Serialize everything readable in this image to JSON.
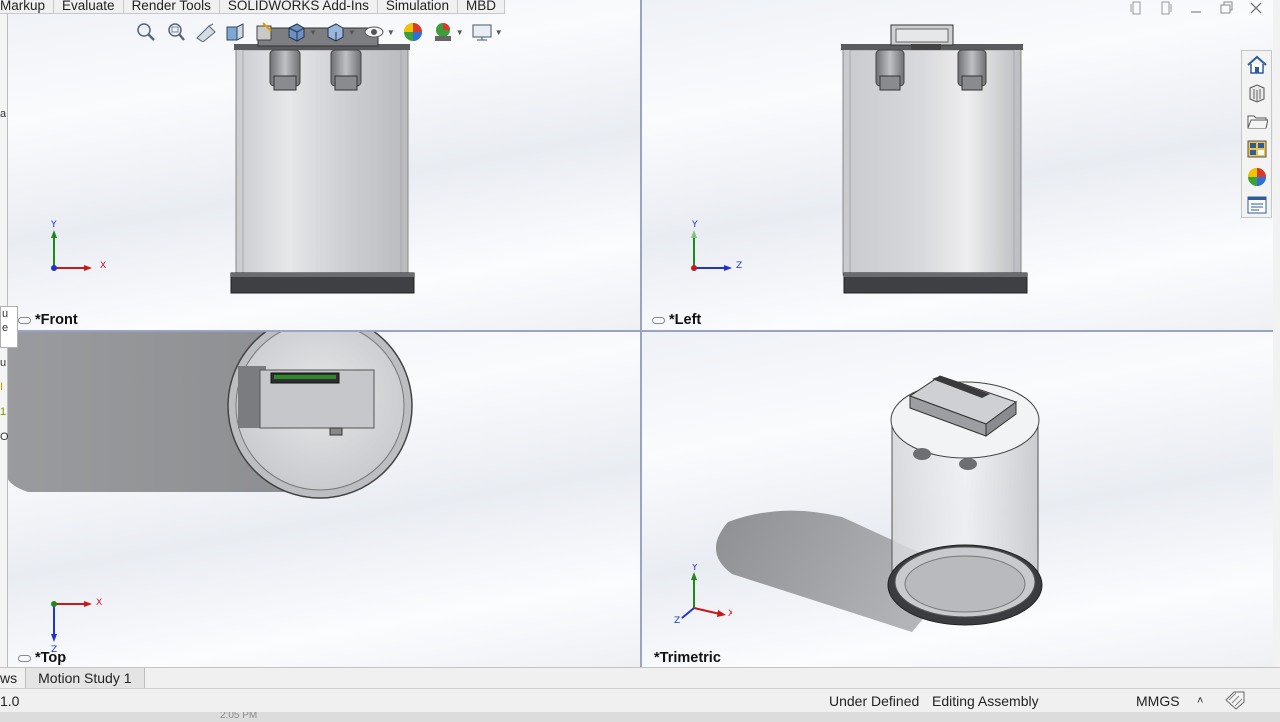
{
  "ribbon": {
    "tabs": [
      "Markup",
      "Evaluate",
      "Render Tools",
      "SOLIDWORKS Add-Ins",
      "Simulation",
      "MBD"
    ]
  },
  "window_controls": {
    "icons": [
      "restore-left-icon",
      "restore-right-icon",
      "minimize-icon",
      "maximize-icon",
      "close-icon"
    ]
  },
  "heads_up_toolbar": {
    "icons": [
      "zoom-to-fit-icon",
      "zoom-to-area-icon",
      "previous-view-icon",
      "section-view-icon",
      "dynamic-annotation-icon",
      "view-orientation-icon",
      "display-style-icon",
      "hide-show-items-icon",
      "edit-appearance-icon",
      "apply-scene-icon",
      "view-settings-icon"
    ]
  },
  "viewports": {
    "front": {
      "label": "*Front",
      "axes": {
        "vertical": "Y",
        "horizontal": "X"
      }
    },
    "left": {
      "label": "*Left",
      "axes": {
        "vertical": "Y",
        "horizontal": "Z"
      }
    },
    "top": {
      "label": "*Top",
      "axes": {
        "vertical": "Z",
        "horizontal": "X"
      }
    },
    "trimetric": {
      "label": "*Trimetric",
      "axes": {
        "vertical": "Y",
        "horizontal": "X",
        "depth": "Z"
      }
    }
  },
  "task_pane": {
    "icons": [
      "home-icon",
      "resources-icon",
      "file-explorer-icon",
      "view-palette-icon",
      "appearances-icon",
      "custom-properties-icon"
    ]
  },
  "left_fragments": [
    "a",
    "u",
    "e",
    "u",
    "I",
    "1",
    "O"
  ],
  "bottom_tabs": [
    "ws",
    "Motion Study 1"
  ],
  "status": {
    "left": "1.0",
    "definition": "Under Defined",
    "mode": "Editing Assembly",
    "units": "MMGS",
    "units_caret": "˄",
    "taskbar_time": "2:05 PM"
  }
}
